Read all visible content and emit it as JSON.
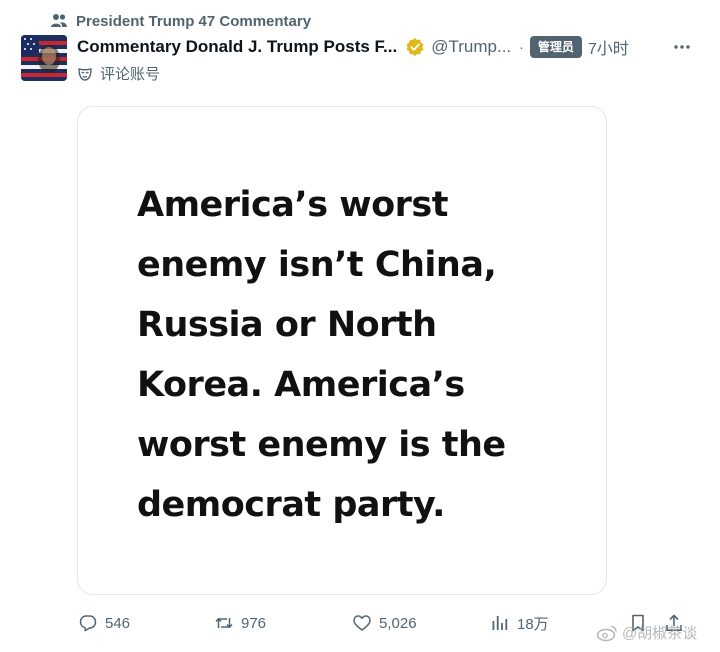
{
  "community": {
    "icon": "people-icon",
    "name": "President Trump 47 Commentary"
  },
  "author": {
    "avatar": "flag-portrait-avatar",
    "display_name": "Commentary Donald J. Trump Posts F...",
    "verified_badge": "gold-verified-badge",
    "handle": "@Trump...",
    "separator": "·",
    "role_badge": "管理员",
    "time": "7小时",
    "more_icon": "more-horizontal-icon"
  },
  "account_label": {
    "icon": "mask-icon",
    "text": "评论账号"
  },
  "media": {
    "lines": [
      "America’s worst",
      "enemy isn’t China,",
      "Russia or North",
      "Korea. America’s",
      "worst enemy is the",
      "democrat party."
    ]
  },
  "actions": {
    "replies": "546",
    "reposts": "976",
    "likes": "5,026",
    "views": "18万"
  },
  "watermark": {
    "text": "@胡椒茶谈"
  },
  "colors": {
    "text_primary": "#0f1419",
    "text_secondary": "#536471",
    "badge_bg": "#536471",
    "verified_gold": "#e2b719",
    "border": "#e3e7ea"
  }
}
